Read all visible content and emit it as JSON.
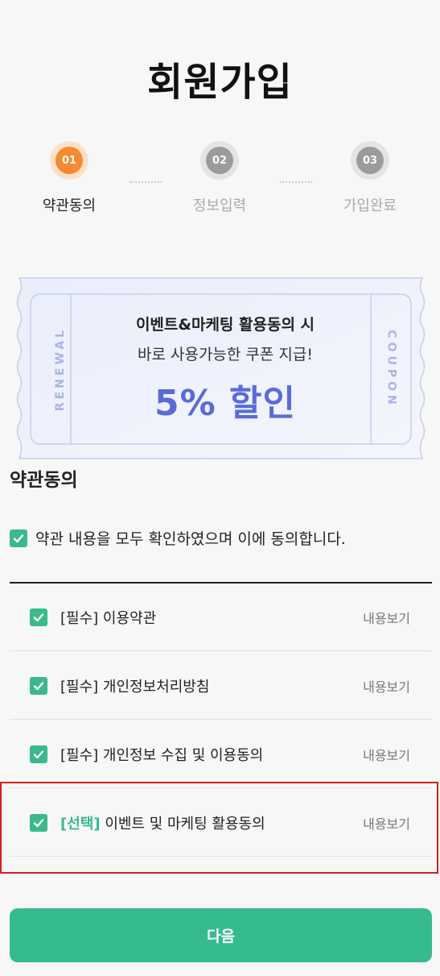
{
  "header": {
    "title": "회원가입"
  },
  "steps": [
    {
      "number": "01",
      "label": "약관동의",
      "active": true
    },
    {
      "number": "02",
      "label": "정보입력",
      "active": false
    },
    {
      "number": "03",
      "label": "가입완료",
      "active": false
    }
  ],
  "coupon": {
    "left_text": "RENEWAL",
    "right_text": "COUPON",
    "line1": "이벤트&마케팅 활용동의 시",
    "line2": "바로 사용가능한 쿠폰 지급!",
    "highlight": "5% 할인"
  },
  "terms": {
    "section_title": "약관동의",
    "all_agree_label": "약관 내용을 모두 확인하였으며 이에 동의합니다.",
    "all_agree_checked": true,
    "items": [
      {
        "tag": "[필수]",
        "label": "이용약관",
        "view": "내용보기",
        "checked": true
      },
      {
        "tag": "[필수]",
        "label": "개인정보처리방침",
        "view": "내용보기",
        "checked": true
      },
      {
        "tag": "[필수]",
        "label": "개인정보 수집 및 이용동의",
        "view": "내용보기",
        "checked": true
      },
      {
        "tag": "[선택]",
        "label": "이벤트 및 마케팅 활용동의",
        "view": "내용보기",
        "checked": true
      }
    ]
  },
  "footer": {
    "next_label": "다음"
  },
  "colors": {
    "accent": "#35bb8c",
    "step_active": "#f7892e",
    "coupon_text": "#5a6bd8",
    "highlight_border": "#d81f1f"
  }
}
